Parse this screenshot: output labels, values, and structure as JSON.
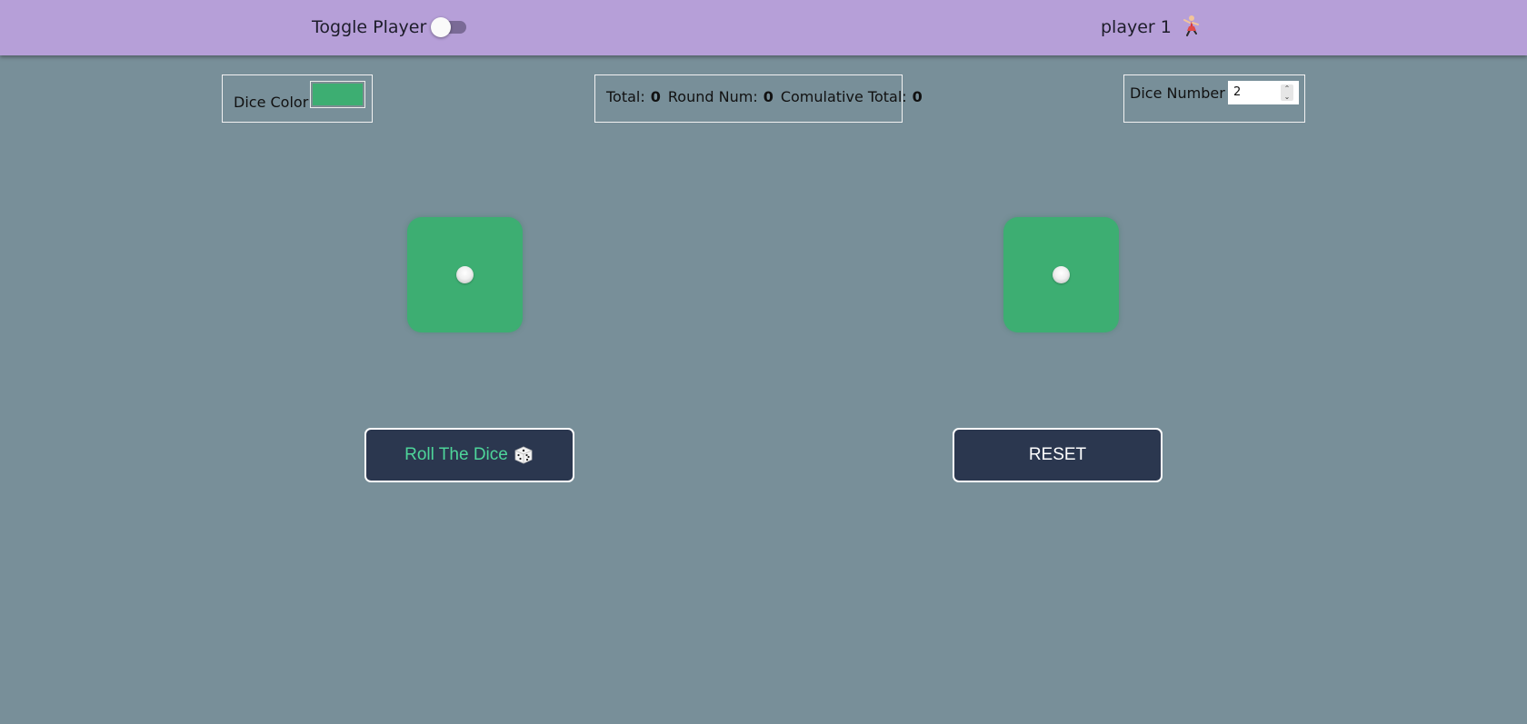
{
  "topbar": {
    "toggle_label": "Toggle Player",
    "toggle_on": false,
    "player_label": "player 1",
    "player_icon": "dancer-icon"
  },
  "controls": {
    "dice_color_label": "Dice Color",
    "dice_color_value": "#3dae72",
    "stats": {
      "total_label": "Total:",
      "total_value": "0",
      "round_label": "Round Num:",
      "round_value": "0",
      "cumulative_label": "Comulative Total:",
      "cumulative_value": "0"
    },
    "dice_number_label": "Dice Number",
    "dice_number_value": "2"
  },
  "dice": [
    {
      "value": 1,
      "color": "#3dae72"
    },
    {
      "value": 1,
      "color": "#3dae72"
    }
  ],
  "buttons": {
    "roll_label": "Roll The Dice",
    "roll_icon": "die-icon",
    "reset_label": "RESET"
  },
  "colors": {
    "background": "#788f99",
    "topbar": "#b69fd8",
    "button_bg": "#2b374f",
    "roll_text": "#4ed59a"
  }
}
